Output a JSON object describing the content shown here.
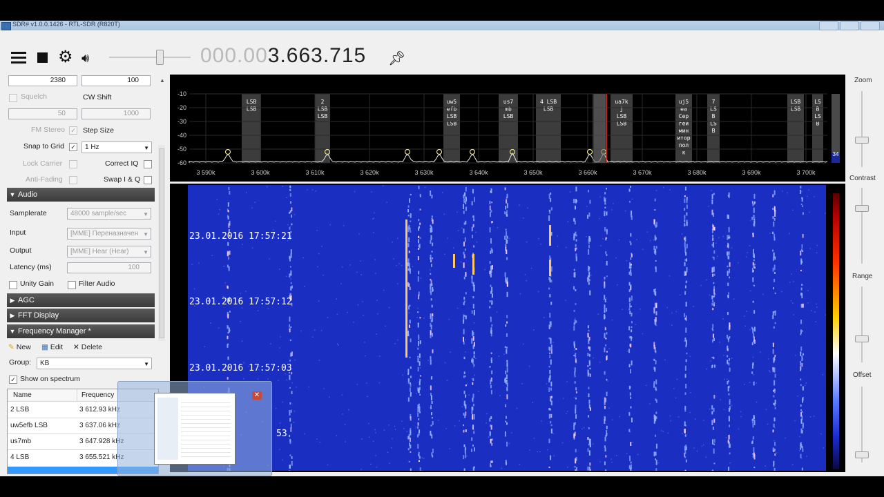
{
  "window": {
    "title": "SDR# v1.0.0.1426 - RTL-SDR (R820T)"
  },
  "toolbar": {
    "frequency_dim": "000.00",
    "frequency_bright": "3.663.715",
    "volume_level": 0.6
  },
  "controls": {
    "filter_bandwidth": "2380",
    "order": "100",
    "squelch_label": "Squelch",
    "cw_shift_label": "CW Shift",
    "squelch_value": "50",
    "cw_shift_value": "1000",
    "fm_stereo_label": "FM Stereo",
    "step_size_label": "Step Size",
    "snap_to_grid_label": "Snap to Grid",
    "step_size_value": "1 Hz",
    "lock_carrier_label": "Lock Carrier",
    "correct_iq_label": "Correct IQ",
    "anti_fading_label": "Anti-Fading",
    "swap_iq_label": "Swap I & Q"
  },
  "audio": {
    "section_label": "Audio",
    "samplerate_label": "Samplerate",
    "samplerate_value": "48000 sample/sec",
    "input_label": "Input",
    "input_value": "[MME] Переназначен",
    "output_label": "Output",
    "output_value": "[MME] Hear (Hear)",
    "latency_label": "Latency (ms)",
    "latency_value": "100",
    "unity_gain_label": "Unity Gain",
    "filter_audio_label": "Filter Audio"
  },
  "agc": {
    "section_label": "AGC"
  },
  "fft": {
    "section_label": "FFT Display"
  },
  "freq_manager": {
    "section_label": "Frequency Manager *",
    "new_label": "New",
    "edit_label": "Edit",
    "delete_label": "Delete",
    "group_label": "Group:",
    "group_value": "KB",
    "show_on_spectrum_label": "Show on spectrum",
    "columns": [
      "Name",
      "Frequency"
    ],
    "rows": [
      {
        "name": "2 LSB",
        "frequency": "3 612.93 kHz"
      },
      {
        "name": "uw5efb LSB",
        "frequency": "3 637.06 kHz"
      },
      {
        "name": "us7mb",
        "frequency": "3 647.928 kHz"
      },
      {
        "name": "4 LSB",
        "frequency": "3 655.521 kHz"
      }
    ]
  },
  "spectrum": {
    "y_ticks": [
      "-10",
      "-20",
      "-30",
      "-40",
      "-50",
      "-60"
    ],
    "x_ticks": [
      "3 590k",
      "3 600k",
      "3 610k",
      "3 620k",
      "3 630k",
      "3 640k",
      "3 650k",
      "3 660k",
      "3 670k",
      "3 680k",
      "3 690k",
      "3 700k"
    ],
    "level_readout": "34",
    "bookmarks": [
      {
        "label": "LSB\n\nLSB"
      },
      {
        "label": "2\nLSB\n\nLSB"
      },
      {
        "label": "uw5\nefb\nLSB\n\nLSB"
      },
      {
        "label": "us7\nmb\n\nLSB"
      },
      {
        "label": "4 LSB\n\nLSB"
      },
      {
        "label": "ua7k\nj\nLSB\n\nLSB"
      },
      {
        "label": "uj5\nea\nCep\nгей\nмин\nитор\nпол\nк"
      },
      {
        "label": "7\nLS\nB\n\nLS\nB"
      },
      {
        "label": "LSB\n\nLSB"
      },
      {
        "label": "LS\nB\n\nLS\nB"
      }
    ]
  },
  "waterfall": {
    "timestamps": [
      "23.01.2016 17:57:21",
      "23.01.2016 17:57:12",
      "23.01.2016 17:57:03",
      "53"
    ]
  },
  "right_sliders": {
    "zoom_label": "Zoom",
    "contrast_label": "Contrast",
    "range_label": "Range",
    "offset_label": "Offset"
  },
  "colors": {
    "waterfall_bg": "#1b2ec2",
    "bookmark_band": "#3c3c3c",
    "spectrum_trace": "#e8e8e8",
    "tuned_marker": "#ff2020"
  }
}
